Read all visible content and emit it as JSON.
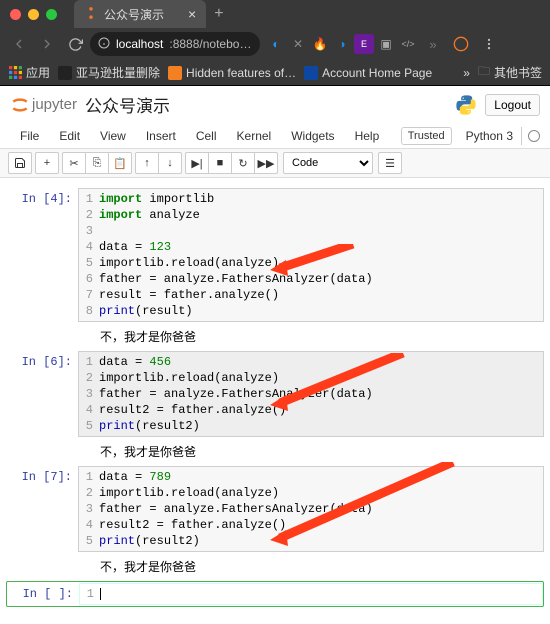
{
  "browser": {
    "tab_title": "公众号演示",
    "url_host": "localhost",
    "url_path": ":8888/notebo…",
    "bookmarks": {
      "apps": "应用",
      "amazon": "亚马逊批量删除",
      "hidden": "Hidden features of…",
      "account": "Account Home Page",
      "other": "其他书签"
    }
  },
  "jupyter": {
    "brand": "jupyter",
    "title": "公众号演示",
    "logout": "Logout",
    "menus": {
      "file": "File",
      "edit": "Edit",
      "view": "View",
      "insert": "Insert",
      "cell": "Cell",
      "kernel": "Kernel",
      "widgets": "Widgets",
      "help": "Help"
    },
    "trusted": "Trusted",
    "kernel": "Python 3",
    "celltype": "Code"
  },
  "cells": [
    {
      "prompt": "In [4]:",
      "code": [
        [
          "kw",
          "import",
          " importlib"
        ],
        [
          "kw",
          "import",
          " analyze"
        ],
        [
          ""
        ],
        [
          "",
          "data = ",
          "num",
          "123"
        ],
        [
          "",
          "importlib.reload(analyze)"
        ],
        [
          "",
          "father = analyze.FathersAnalyzer(data)"
        ],
        [
          "",
          "result = father.analyze()"
        ],
        [
          "fn",
          "print",
          "(result)"
        ]
      ],
      "output": "不，我才是你爸爸"
    },
    {
      "prompt": "In [6]:",
      "running": true,
      "code": [
        [
          "",
          "data = ",
          "num",
          "456"
        ],
        [
          "",
          "importlib.reload(analyze)"
        ],
        [
          "",
          "father = analyze.FathersAnalyzer(data)"
        ],
        [
          "",
          "result2 = father.analyze()"
        ],
        [
          "fn",
          "print",
          "(result2)"
        ]
      ],
      "output": "不，我才是你爸爸"
    },
    {
      "prompt": "In [7]:",
      "code": [
        [
          "",
          "data = ",
          "num",
          "789"
        ],
        [
          "",
          "importlib.reload(analyze)"
        ],
        [
          "",
          "father = analyze.FathersAnalyzer(data)"
        ],
        [
          "",
          "result2 = father.analyze()"
        ],
        [
          "fn",
          "print",
          "(result2)"
        ]
      ],
      "output": "不，我才是你爸爸"
    },
    {
      "prompt": "In [ ]:",
      "empty": true,
      "selected": true
    }
  ]
}
